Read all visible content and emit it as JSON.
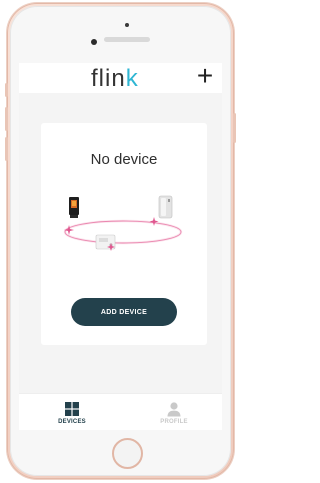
{
  "header": {
    "brand_main": "flin",
    "brand_accent": "k",
    "add_label": "+"
  },
  "card": {
    "title": "No device",
    "button_label": "ADD DEVICE"
  },
  "tabbar": {
    "tabs": [
      {
        "label": "DEVICES",
        "icon": "grid-icon",
        "active": true
      },
      {
        "label": "PROFILE",
        "icon": "person-icon",
        "active": false
      }
    ]
  },
  "colors": {
    "brand_accent": "#2fb6d3",
    "button_bg": "#23414c",
    "orbit": "#e0578f",
    "phone_shell": "#f4d3c6"
  }
}
